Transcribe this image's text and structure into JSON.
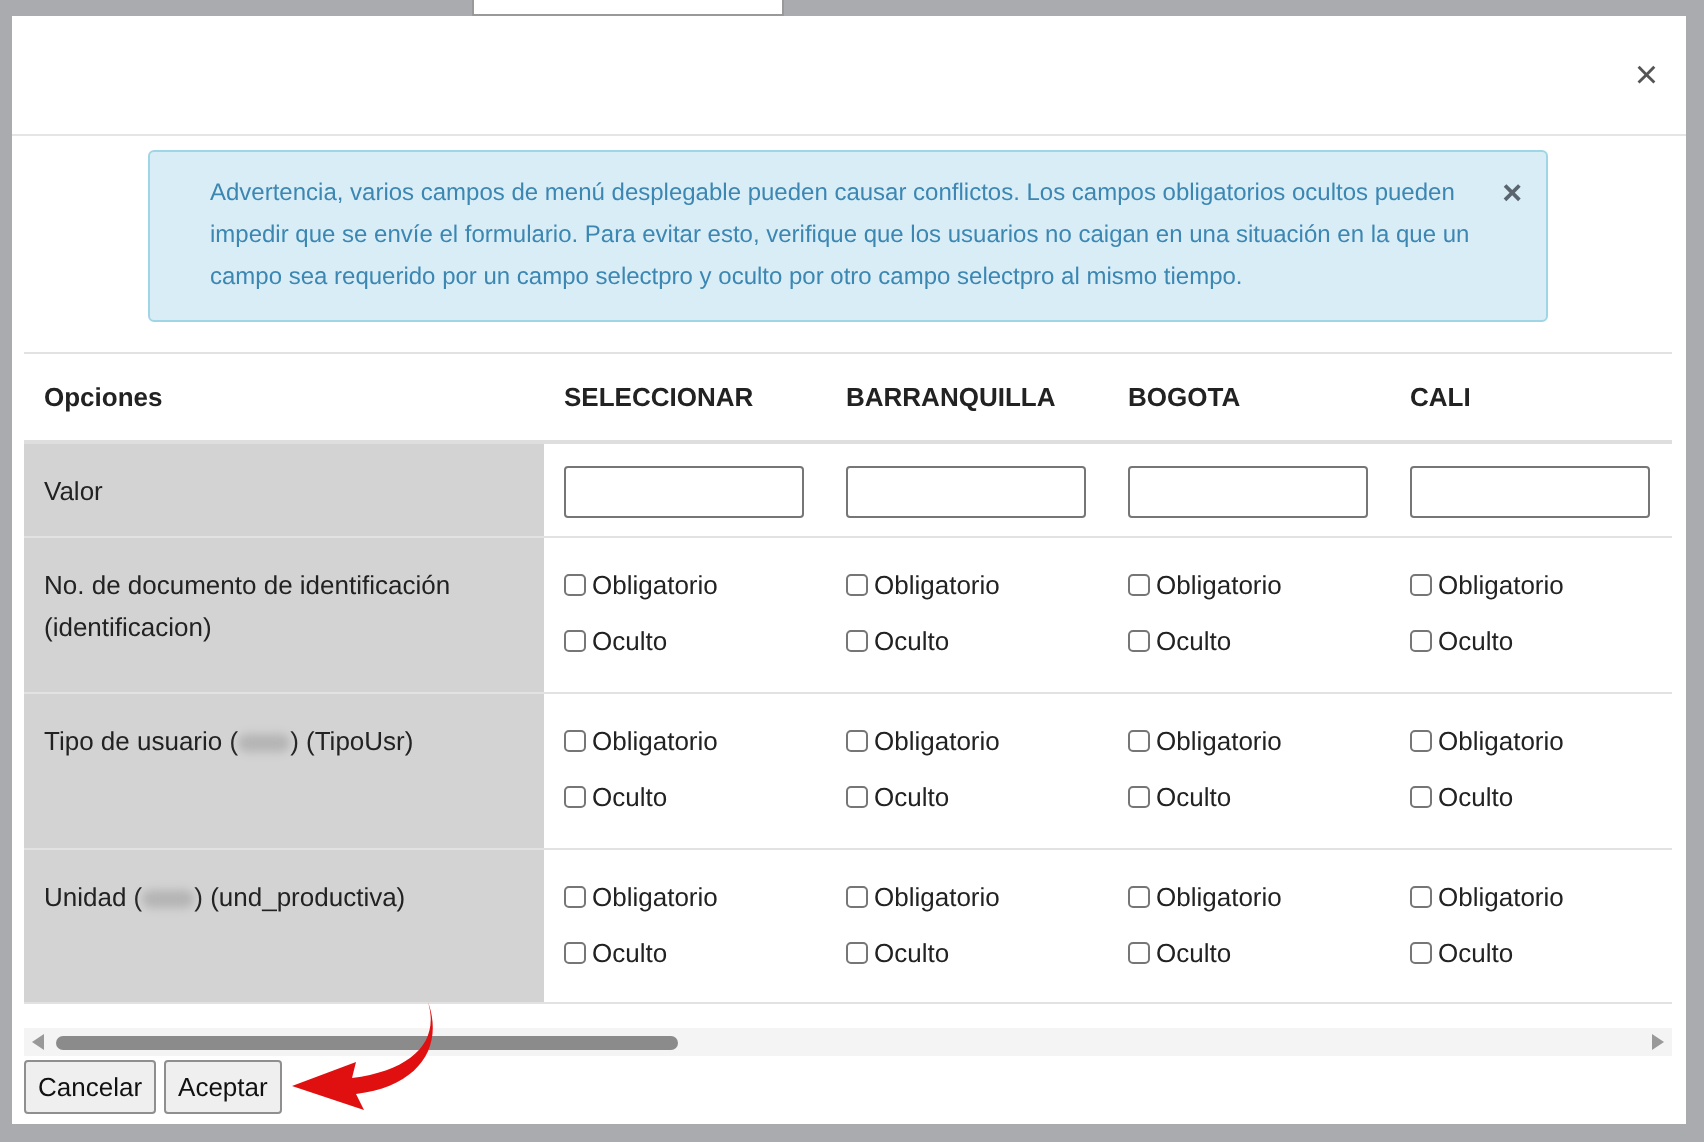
{
  "modal": {
    "close": "×"
  },
  "alert": {
    "text": "Advertencia, varios campos de menú desplegable pueden causar conflictos. Los campos obligatorios ocultos pueden impedir que se envíe el formulario. Para evitar esto, verifique que los usuarios no caigan en una situación en la que un campo sea requerido por un campo selectpro y oculto por otro campo selectpro al mismo tiempo.",
    "close": "×"
  },
  "table": {
    "columns": [
      "Opciones",
      "SELECCIONAR",
      "BARRANQUILLA",
      "BOGOTA",
      "CALI"
    ],
    "rows": [
      {
        "kind": "input",
        "redacted": false,
        "cells": [
          {
            "kind": "label",
            "text": [
              "Valor"
            ]
          },
          {
            "kind": "field"
          },
          {
            "kind": "field"
          },
          {
            "kind": "field"
          },
          {
            "kind": "field"
          }
        ]
      },
      {
        "kind": "checks",
        "redacted": false,
        "cells": [
          {
            "kind": "label",
            "text": [
              "No. de documento de identificación (identificacion)"
            ]
          },
          {
            "options": [
              {
                "label": "Obligatorio",
                "checked": false
              },
              {
                "label": "Oculto",
                "checked": false
              }
            ]
          },
          {
            "options": [
              {
                "label": "Obligatorio",
                "checked": false
              },
              {
                "label": "Oculto",
                "checked": false
              }
            ]
          },
          {
            "options": [
              {
                "label": "Obligatorio",
                "checked": false
              },
              {
                "label": "Oculto",
                "checked": false
              }
            ]
          },
          {
            "options": [
              {
                "label": "Obligatorio",
                "checked": false
              },
              {
                "label": "Oculto",
                "checked": false
              }
            ]
          }
        ]
      },
      {
        "kind": "checks",
        "redacted": true,
        "cells": [
          {
            "kind": "label",
            "text": [
              "Tipo de usuario (",
              ") (TipoUsr)"
            ]
          },
          {
            "options": [
              {
                "label": "Obligatorio",
                "checked": false
              },
              {
                "label": "Oculto",
                "checked": false
              }
            ]
          },
          {
            "options": [
              {
                "label": "Obligatorio",
                "checked": false
              },
              {
                "label": "Oculto",
                "checked": false
              }
            ]
          },
          {
            "options": [
              {
                "label": "Obligatorio",
                "checked": false
              },
              {
                "label": "Oculto",
                "checked": false
              }
            ]
          },
          {
            "options": [
              {
                "label": "Obligatorio",
                "checked": false
              },
              {
                "label": "Oculto",
                "checked": false
              }
            ]
          }
        ]
      },
      {
        "kind": "checks",
        "redacted": true,
        "cells": [
          {
            "kind": "label",
            "text": [
              "Unidad (",
              ") (und_productiva)"
            ]
          },
          {
            "options": [
              {
                "label": "Obligatorio",
                "checked": false
              },
              {
                "label": "Oculto",
                "checked": false
              }
            ]
          },
          {
            "options": [
              {
                "label": "Obligatorio",
                "checked": false
              },
              {
                "label": "Oculto",
                "checked": false
              }
            ]
          },
          {
            "options": [
              {
                "label": "Obligatorio",
                "checked": false
              },
              {
                "label": "Oculto",
                "checked": false
              }
            ]
          },
          {
            "options": [
              {
                "label": "Obligatorio",
                "checked": false
              },
              {
                "label": "Oculto",
                "checked": false
              }
            ]
          }
        ]
      }
    ]
  },
  "buttons": [
    "Cancelar",
    "Aceptar"
  ]
}
